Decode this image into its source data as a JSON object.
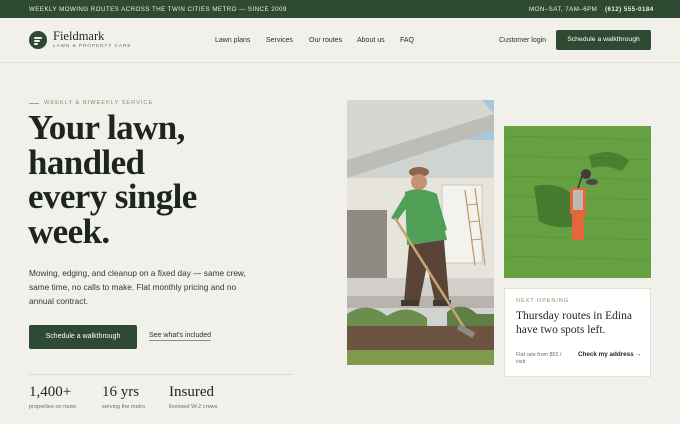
{
  "announcement": {
    "text": "WEEKLY MOWING ROUTES ACROSS THE TWIN CITIES METRO — SINCE 2009",
    "hours": "MON–SAT, 7AM–6PM",
    "phone": "(612) 555-0184"
  },
  "nav": {
    "brand": "Fieldmark",
    "tagline": "LAWN & PROPERTY CARE",
    "links": [
      "Lawn plans",
      "Services",
      "Our routes",
      "About us",
      "FAQ"
    ],
    "login": "Customer login",
    "cta": "Schedule a walkthrough"
  },
  "hero": {
    "eyebrow": "WEEKLY & BIWEEKLY SERVICE",
    "headline": [
      "Your lawn,",
      "handled",
      "every single",
      "week."
    ],
    "lede": "Mowing, edging, and cleanup on a fixed day — same crew, same time, no calls to make. Flat monthly pricing and no annual contract.",
    "primary_cta": "Schedule a walkthrough",
    "secondary_cta": "See what's included"
  },
  "stats": [
    {
      "value": "1,400+",
      "label": "properties on route"
    },
    {
      "value": "16 yrs",
      "label": "serving the metro"
    },
    {
      "value": "Insured",
      "label": "licensed W-2 crews"
    }
  ],
  "card": {
    "eyebrow": "NEXT OPENING",
    "title": "Thursday routes in Edina have two spots left.",
    "note": "Flat rate from $52 / visit",
    "link": "Check my address →"
  },
  "colors": {
    "brand_green": "#2e4a32",
    "accent_sage": "#7c9a6d",
    "background": "#f2f0ea"
  }
}
